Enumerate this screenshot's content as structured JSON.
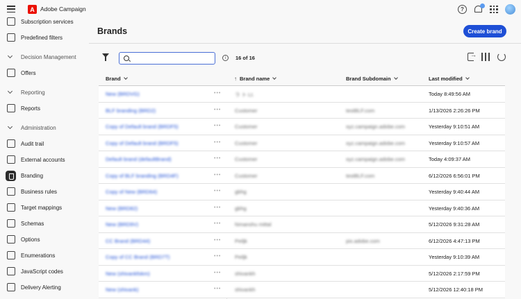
{
  "app": {
    "name": "Adobe Campaign",
    "logo_letter": "A"
  },
  "sidebar": {
    "items": [
      {
        "label": "Subscription services",
        "icon": "envelope-icon"
      },
      {
        "label": "Predefined filters",
        "icon": "filter-settings-icon"
      },
      {
        "section": "Decision Management"
      },
      {
        "label": "Offers",
        "icon": "offer-icon"
      },
      {
        "section": "Reporting"
      },
      {
        "label": "Reports",
        "icon": "bar-chart-icon"
      },
      {
        "section": "Administration"
      },
      {
        "label": "Audit trail",
        "icon": "audit-icon"
      },
      {
        "label": "External accounts",
        "icon": "login-icon"
      },
      {
        "label": "Branding",
        "icon": "beaker-icon",
        "active": true
      },
      {
        "label": "Business rules",
        "icon": "gavel-icon"
      },
      {
        "label": "Target mappings",
        "icon": "target-icon"
      },
      {
        "label": "Schemas",
        "icon": "schema-icon"
      },
      {
        "label": "Options",
        "icon": "options-icon"
      },
      {
        "label": "Enumerations",
        "icon": "list-icon"
      },
      {
        "label": "JavaScript codes",
        "icon": "code-icon"
      },
      {
        "label": "Delivery Alerting",
        "icon": "alert-envelope-icon"
      }
    ]
  },
  "main": {
    "title": "Brands",
    "create_button": "Create brand",
    "search_placeholder": "",
    "count": "16 of 16",
    "info_glyph": "i",
    "columns": [
      "Brand",
      "Brand name",
      "Brand Subdomain",
      "Last modified"
    ],
    "rows": [
      {
        "brand": "New (BRDVG)",
        "name": "ラ ト Lt.",
        "sub": "",
        "date": "Today 8:49:56 AM"
      },
      {
        "brand": "BLF branding (BRD2)",
        "name": "Customer",
        "sub": "testBLF.com",
        "date": "1/13/2026 2:26:26 PM"
      },
      {
        "brand": "Copy of Default brand (BRDF5)",
        "name": "Customer",
        "sub": "xyz.campaign.adobe.com",
        "date": "Yesterday 9:10:51 AM"
      },
      {
        "brand": "Copy of Default brand (BRDF5)",
        "name": "Customer",
        "sub": "xyz.campaign.adobe.com",
        "date": "Yesterday 9:10:57 AM"
      },
      {
        "brand": "Default brand (defaultBrand)",
        "name": "Customer",
        "sub": "xyz.campaign.adobe.com",
        "date": "Today 4:09:37 AM"
      },
      {
        "brand": "Copy of BLF branding (BRD4F)",
        "name": "Customer",
        "sub": "testBLF.com",
        "date": "6/12/2026 6:56:01 PM"
      },
      {
        "brand": "Copy of New (BRD64)",
        "name": "gbhg",
        "sub": "",
        "date": "Yesterday 9:40:44 AM"
      },
      {
        "brand": "New (BRD82)",
        "name": "gbhg",
        "sub": "",
        "date": "Yesterday 9:40:36 AM"
      },
      {
        "brand": "New (BRD9V)",
        "name": "himanshu mittal",
        "sub": "",
        "date": "5/12/2026 9:31:28 AM"
      },
      {
        "brand": "CC Brand (BRD44)",
        "name": "Peiljk",
        "sub": "pix.adobe.com",
        "date": "6/12/2026 4:47:13 PM"
      },
      {
        "brand": "Copy of CC Brand (BRD7T)",
        "name": "Peiljk",
        "sub": "",
        "date": "Yesterday 9:10:39 AM"
      },
      {
        "brand": "New (shivankfokm)",
        "name": "shivankh",
        "sub": "",
        "date": "5/12/2026 2:17:59 PM"
      },
      {
        "brand": "New (shivank)",
        "name": "shivankh",
        "sub": "",
        "date": "5/12/2026 12:40:18 PM"
      }
    ]
  },
  "colors": {
    "accent": "#1e4fd6",
    "logo": "#eb1000"
  }
}
